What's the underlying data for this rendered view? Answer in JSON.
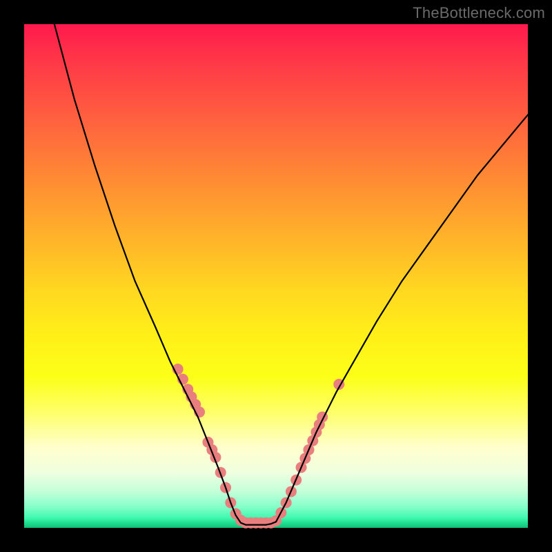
{
  "watermark": {
    "text": "TheBottleneck.com"
  },
  "chart_data": {
    "type": "line",
    "title": "",
    "xlabel": "",
    "ylabel": "",
    "xlim": [
      0,
      100
    ],
    "ylim": [
      0,
      100
    ],
    "grid": false,
    "series": [
      {
        "name": "left-curve",
        "x": [
          6,
          10,
          14,
          18,
          22,
          26,
          29,
          32,
          34.5,
          36.5,
          38.5,
          40,
          41,
          42,
          43
        ],
        "y": [
          100,
          85,
          72,
          60,
          49,
          40,
          33,
          27,
          22,
          17,
          12,
          8,
          5,
          2.5,
          1
        ]
      },
      {
        "name": "valley-floor",
        "x": [
          43,
          44,
          45,
          46,
          47,
          48,
          49,
          50
        ],
        "y": [
          1,
          0.6,
          0.6,
          0.6,
          0.6,
          0.6,
          0.8,
          1.2
        ]
      },
      {
        "name": "right-curve",
        "x": [
          50,
          52,
          55,
          58,
          62,
          66,
          70,
          75,
          80,
          85,
          90,
          95,
          100
        ],
        "y": [
          1.2,
          5,
          12,
          19,
          27,
          34,
          41,
          49,
          56,
          63,
          70,
          76,
          82
        ]
      }
    ],
    "markers": [
      {
        "name": "left-branch-dots",
        "x": [
          30.5,
          31.5,
          32.5,
          33.2,
          34.0,
          34.8,
          36.5,
          37.3,
          38.0,
          39.0,
          40.0,
          41.0,
          42.0,
          43.0,
          44.0,
          45.0,
          46.0,
          47.0,
          48.0
        ],
        "y": [
          31.5,
          29.5,
          27.5,
          26.0,
          24.5,
          23.0,
          17.0,
          15.5,
          14.0,
          11.0,
          8.0,
          5.0,
          2.8,
          1.5,
          1.0,
          1.0,
          1.0,
          1.0,
          1.0
        ]
      },
      {
        "name": "right-branch-dots",
        "x": [
          49.0,
          50.0,
          51.0,
          52.0,
          53.0,
          54.0,
          55.0,
          55.8,
          56.5,
          57.3,
          58.0,
          58.6,
          59.2,
          62.5
        ],
        "y": [
          1.0,
          1.4,
          3.0,
          5.0,
          7.2,
          9.5,
          12.0,
          13.8,
          15.5,
          17.3,
          19.0,
          20.5,
          22.0,
          28.5
        ]
      }
    ],
    "style": {
      "curve_color": "#000000",
      "curve_width": 2.2,
      "marker_color": "#e97e7e",
      "marker_radius": 8
    }
  }
}
